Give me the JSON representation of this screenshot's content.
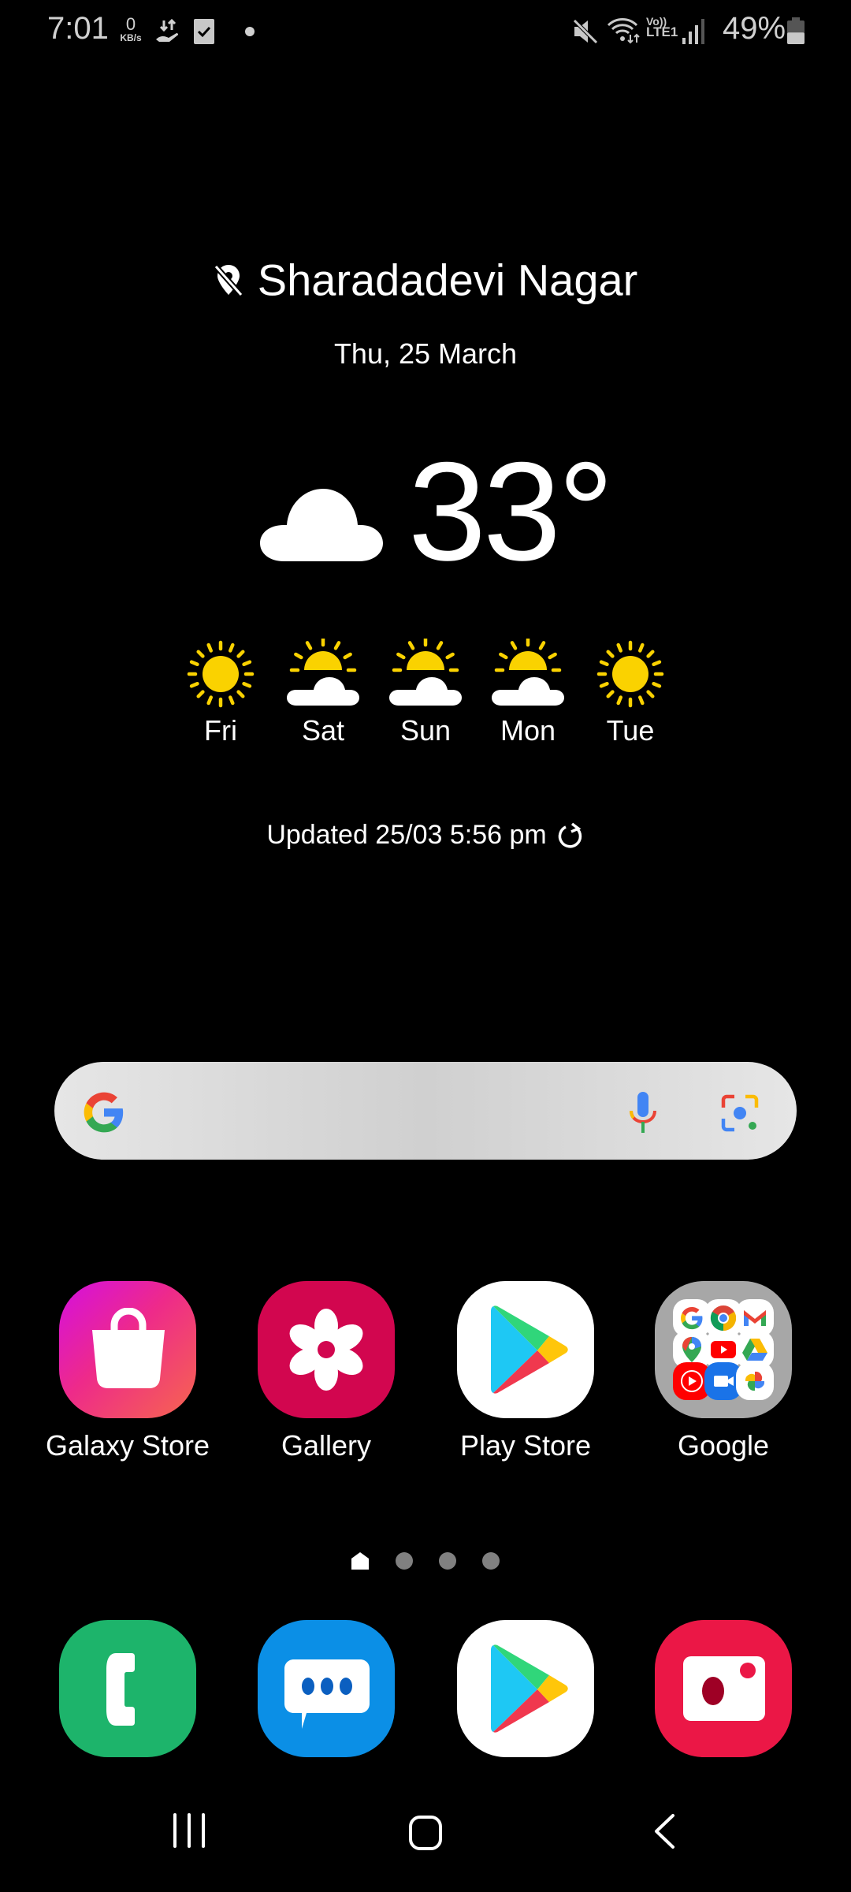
{
  "status_bar": {
    "time": "7:01",
    "net_speed_value": "0",
    "net_speed_unit": "KB/s",
    "left_icons": [
      "data-transfer-icon",
      "checkbox-notification-icon",
      "notification-dot-icon"
    ],
    "right_icons": [
      "mute-icon",
      "wifi-icon",
      "volte-lte1-icon",
      "signal-icon"
    ],
    "volte_label": "Vo))",
    "lte_label": "LTE1",
    "battery_percent": "49%",
    "battery_level": 0.49
  },
  "weather": {
    "location": "Sharadadevi Nagar",
    "location_icon": "location-off-icon",
    "date": "Thu, 25 March",
    "current_condition_icon": "cloud-icon",
    "temperature": "33°",
    "forecast": [
      {
        "day": "Fri",
        "icon": "sunny"
      },
      {
        "day": "Sat",
        "icon": "partly-cloudy"
      },
      {
        "day": "Sun",
        "icon": "partly-cloudy"
      },
      {
        "day": "Mon",
        "icon": "partly-cloudy"
      },
      {
        "day": "Tue",
        "icon": "sunny"
      }
    ],
    "updated": "Updated 25/03 5:56 pm",
    "refresh_icon": "refresh-icon"
  },
  "search": {
    "icons": [
      "google-g-icon",
      "microphone-icon",
      "google-lens-icon"
    ]
  },
  "apps": [
    {
      "label": "Galaxy Store",
      "icon": "shopping-bag-icon"
    },
    {
      "label": "Gallery",
      "icon": "flower-icon"
    },
    {
      "label": "Play Store",
      "icon": "play-store-icon"
    },
    {
      "label": "Google",
      "icon": "folder-icon",
      "folder_contents": [
        "Google",
        "Chrome",
        "Gmail",
        "Maps",
        "YouTube",
        "Drive",
        "YT Music",
        "Duo",
        "Photos"
      ]
    }
  ],
  "page_indicator": {
    "pages": 4,
    "current": 1,
    "home_icon": "home-page-icon"
  },
  "dock": [
    {
      "name": "Phone",
      "icon": "phone-icon"
    },
    {
      "name": "Messages",
      "icon": "message-icon"
    },
    {
      "name": "Play Store",
      "icon": "play-store-icon"
    },
    {
      "name": "Camera",
      "icon": "camera-icon"
    }
  ],
  "nav_bar": {
    "recents": "recents-icon",
    "home": "home-icon",
    "back": "back-icon"
  },
  "colors": {
    "background": "#000000",
    "sun_yellow": "#fad200",
    "gallery": "#d2064f",
    "phone": "#1db46b",
    "messages": "#0b8fe6",
    "camera": "#eb1746"
  }
}
